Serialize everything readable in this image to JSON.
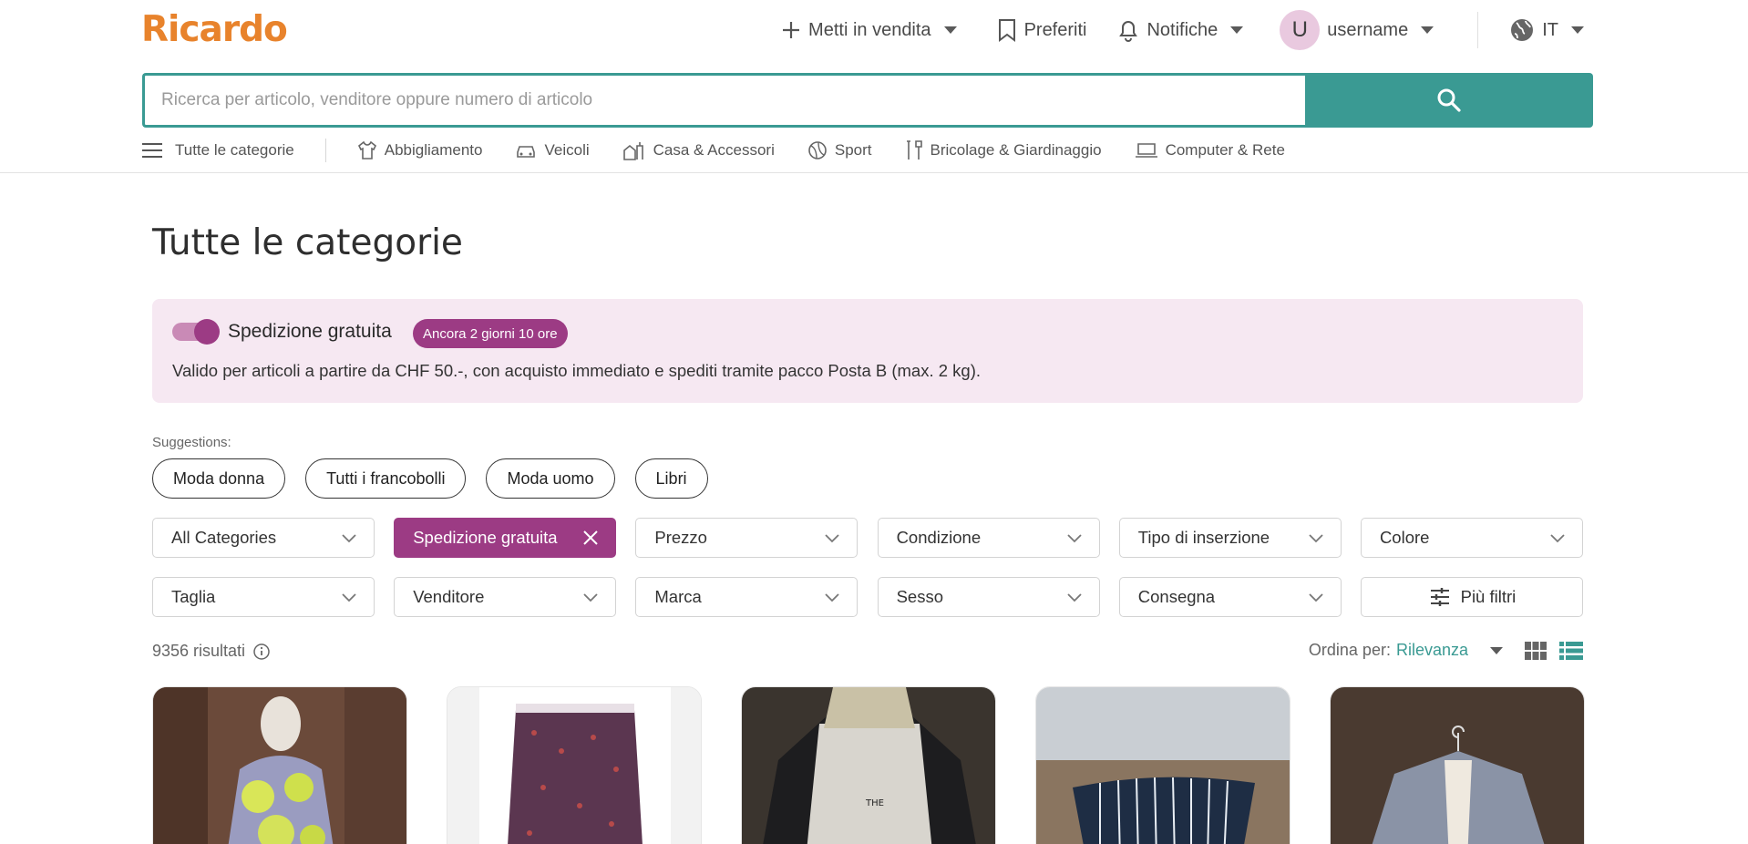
{
  "brand": {
    "name": "Ricardo",
    "accent": "#e8832c",
    "teal": "#3a9a93",
    "plum": "#9c3b84"
  },
  "topnav": {
    "sell": "Metti in vendita",
    "favorites": "Preferiti",
    "notifications": "Notifiche",
    "user_initial": "U",
    "username": "username",
    "language": "IT"
  },
  "search": {
    "placeholder": "Ricerca per articolo, venditore oppure numero di articolo",
    "value": ""
  },
  "categories": {
    "all": "Tutte le categorie",
    "items": [
      {
        "label": "Abbigliamento",
        "icon": "shirt-icon"
      },
      {
        "label": "Veicoli",
        "icon": "car-icon"
      },
      {
        "label": "Casa & Accessori",
        "icon": "house-icon"
      },
      {
        "label": "Sport",
        "icon": "ball-icon"
      },
      {
        "label": "Bricolage & Giardinaggio",
        "icon": "tools-icon"
      },
      {
        "label": "Computer & Rete",
        "icon": "laptop-icon"
      }
    ]
  },
  "main": {
    "title": "Tutte le categorie",
    "promo": {
      "title": "Spedizione gratuita",
      "badge": "Ancora 2 giorni 10 ore",
      "description": "Valido per articoli a partire da CHF 50.-, con acquisto immediato e spediti tramite pacco Posta B (max. 2 kg).",
      "enabled": true
    },
    "suggestions": {
      "label": "Suggestions:",
      "chips": [
        "Moda donna",
        "Tutti i francobolli",
        "Moda uomo",
        "Libri"
      ]
    },
    "filters": {
      "row1": [
        "All Categories",
        "Spedizione gratuita",
        "Prezzo",
        "Condizione",
        "Tipo di inserzione",
        "Colore"
      ],
      "row2": [
        "Taglia",
        "Venditore",
        "Marca",
        "Sesso",
        "Consegna",
        "Più filtri"
      ]
    },
    "results_count": "9356 risultati",
    "sort": {
      "label": "Ordina per:",
      "value": "Rilevanza"
    }
  }
}
